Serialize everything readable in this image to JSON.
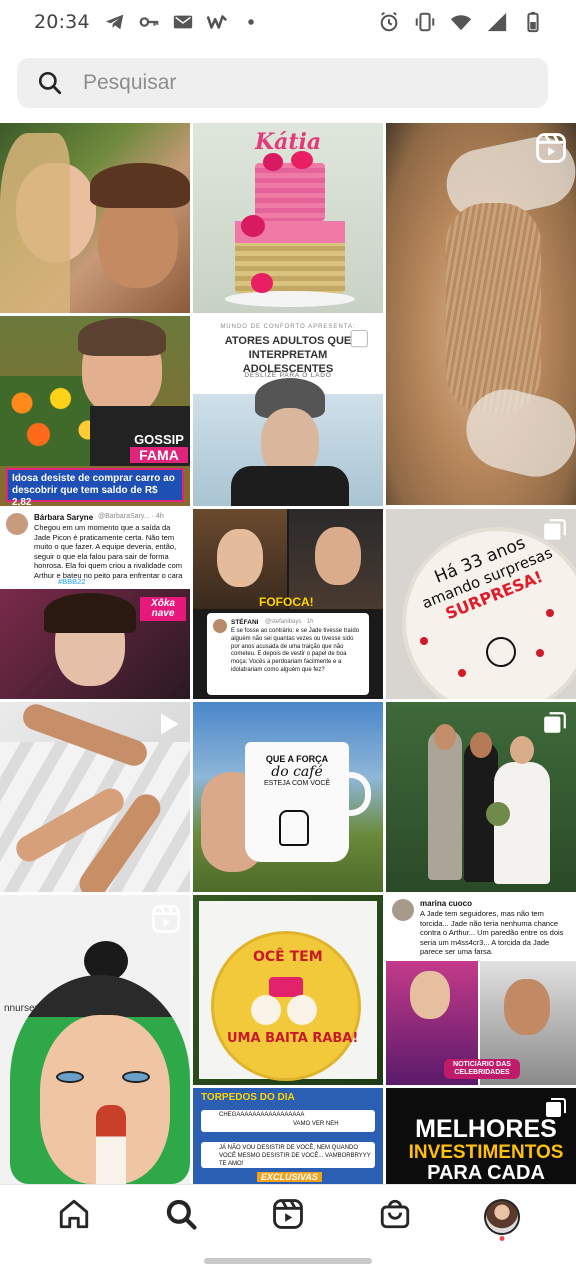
{
  "status_bar": {
    "time": "20:34",
    "left_icons": [
      "telegram-icon",
      "key-icon",
      "vpn-mail-icon",
      "w-app-icon",
      "dot-icon"
    ],
    "right_icons": [
      "alarm-icon",
      "vibrate-icon",
      "wifi-icon",
      "signal-icon",
      "battery-icon"
    ]
  },
  "search": {
    "placeholder": "Pesquisar",
    "value": ""
  },
  "grid": {
    "tiles": [
      {
        "id": "couple-selfie",
        "type": "image"
      },
      {
        "id": "katia-cake",
        "type": "image",
        "text": "Kátia"
      },
      {
        "id": "slime-reel",
        "type": "reel"
      },
      {
        "id": "gossip-fama",
        "type": "image",
        "caption": "Idosa desiste de comprar carro ao descobrir que tem saldo de R$ 2,82",
        "logo_top": "GOSSIP",
        "logo_bottom": "FAMA"
      },
      {
        "id": "atores-adultos",
        "type": "carousel",
        "header": "MUNDO DE CONFORTO APRESENTA:",
        "title": "ATORES ADULTOS QUE INTERPRETAM ADOLESCENTES",
        "subtitle": "DESLIZE PARA O LADO"
      },
      {
        "id": "barbara-tweet",
        "type": "image",
        "author": "Bárbara Saryne",
        "handle": "@BarbaraSary... · 4h",
        "text": "Chegou em um momento que a saída da Jade Picon é praticamente certa. Não tem muito o que fazer. A equipe deveria, então, seguir o que ela falou para sair de forma honrosa. Ela foi quem criou a rivalidade com Arthur e bateu no peito para enfrentar o cara",
        "hashtag": "#BBB22",
        "badge": "Xôka nave"
      },
      {
        "id": "fofoca-tweet",
        "type": "image",
        "label": "FOFOCA!",
        "author": "STÉFANI",
        "handle": "@stefanibays · 1h",
        "text": "E se fosse ao contrário: e se Jade tivesse traído alguém não sei quantas vezes ou tivesse sido por anos acusada de uma traição que não cometeu. E depois de vestir o papel de boa moça: Vocês a perdoariam facilmente e a idolatrariam como alguém que fez?"
      },
      {
        "id": "surprise-cake",
        "type": "carousel",
        "text_line1": "Há 33 anos",
        "text_line2": "amando surpresas",
        "text_line3": "SURPRESA!"
      },
      {
        "id": "feet-reel",
        "type": "video"
      },
      {
        "id": "cafe-mug",
        "type": "image",
        "mug_line1": "QUE A FORÇA",
        "mug_line2": "do café",
        "mug_line3": "ESTEJA COM VOCÊ"
      },
      {
        "id": "wedding",
        "type": "carousel"
      },
      {
        "id": "illustration",
        "type": "reel",
        "watermark": "nnursema"
      },
      {
        "id": "rabao-cake",
        "type": "image",
        "line1": "OCÊ TEM",
        "line2": "UMA BAITA RABA!"
      },
      {
        "id": "marina-tweet",
        "type": "image",
        "author": "marina cuoco",
        "text": "A Jade tem seguidores, mas não tem torcida... Jade não teria nenhuma chance contra o Arthur... Um paredão entre os dois seria um m4ss4cr3... A torcida da Jade parece ser uma farsa.",
        "badge": "NOTICIÁRIO DAS CELEBRIDADES"
      },
      {
        "id": "torpedos",
        "type": "image",
        "title": "TORPEDOS DO DIA",
        "row1": "CHEGAAAAAAAAAAAAAAAAA",
        "row1_sub": "VAMO VER NEH",
        "row2": "JÁ NÃO VOU DESISTIR DE VOCÊ, NEM QUANDO VOCÊ MESMO DESISTIR DE VOCÊ... VAMBORBRYYY TE AMO!",
        "badge": "EXCLUSIVAS"
      },
      {
        "id": "investimentos",
        "type": "carousel",
        "line1": "MELHORES",
        "line2": "INVESTIMENTOS",
        "line3": "PARA CADA"
      }
    ]
  },
  "bottom_nav": {
    "items": [
      {
        "name": "home",
        "icon": "home-icon"
      },
      {
        "name": "search",
        "icon": "search-icon",
        "active": true
      },
      {
        "name": "reels",
        "icon": "reels-icon"
      },
      {
        "name": "shop",
        "icon": "shop-icon"
      },
      {
        "name": "profile",
        "icon": "avatar"
      }
    ]
  },
  "colors": {
    "accent_notification": "#ed4956",
    "search_bg": "#efefef",
    "text_primary": "#262626",
    "placeholder": "#8e8e8e"
  }
}
